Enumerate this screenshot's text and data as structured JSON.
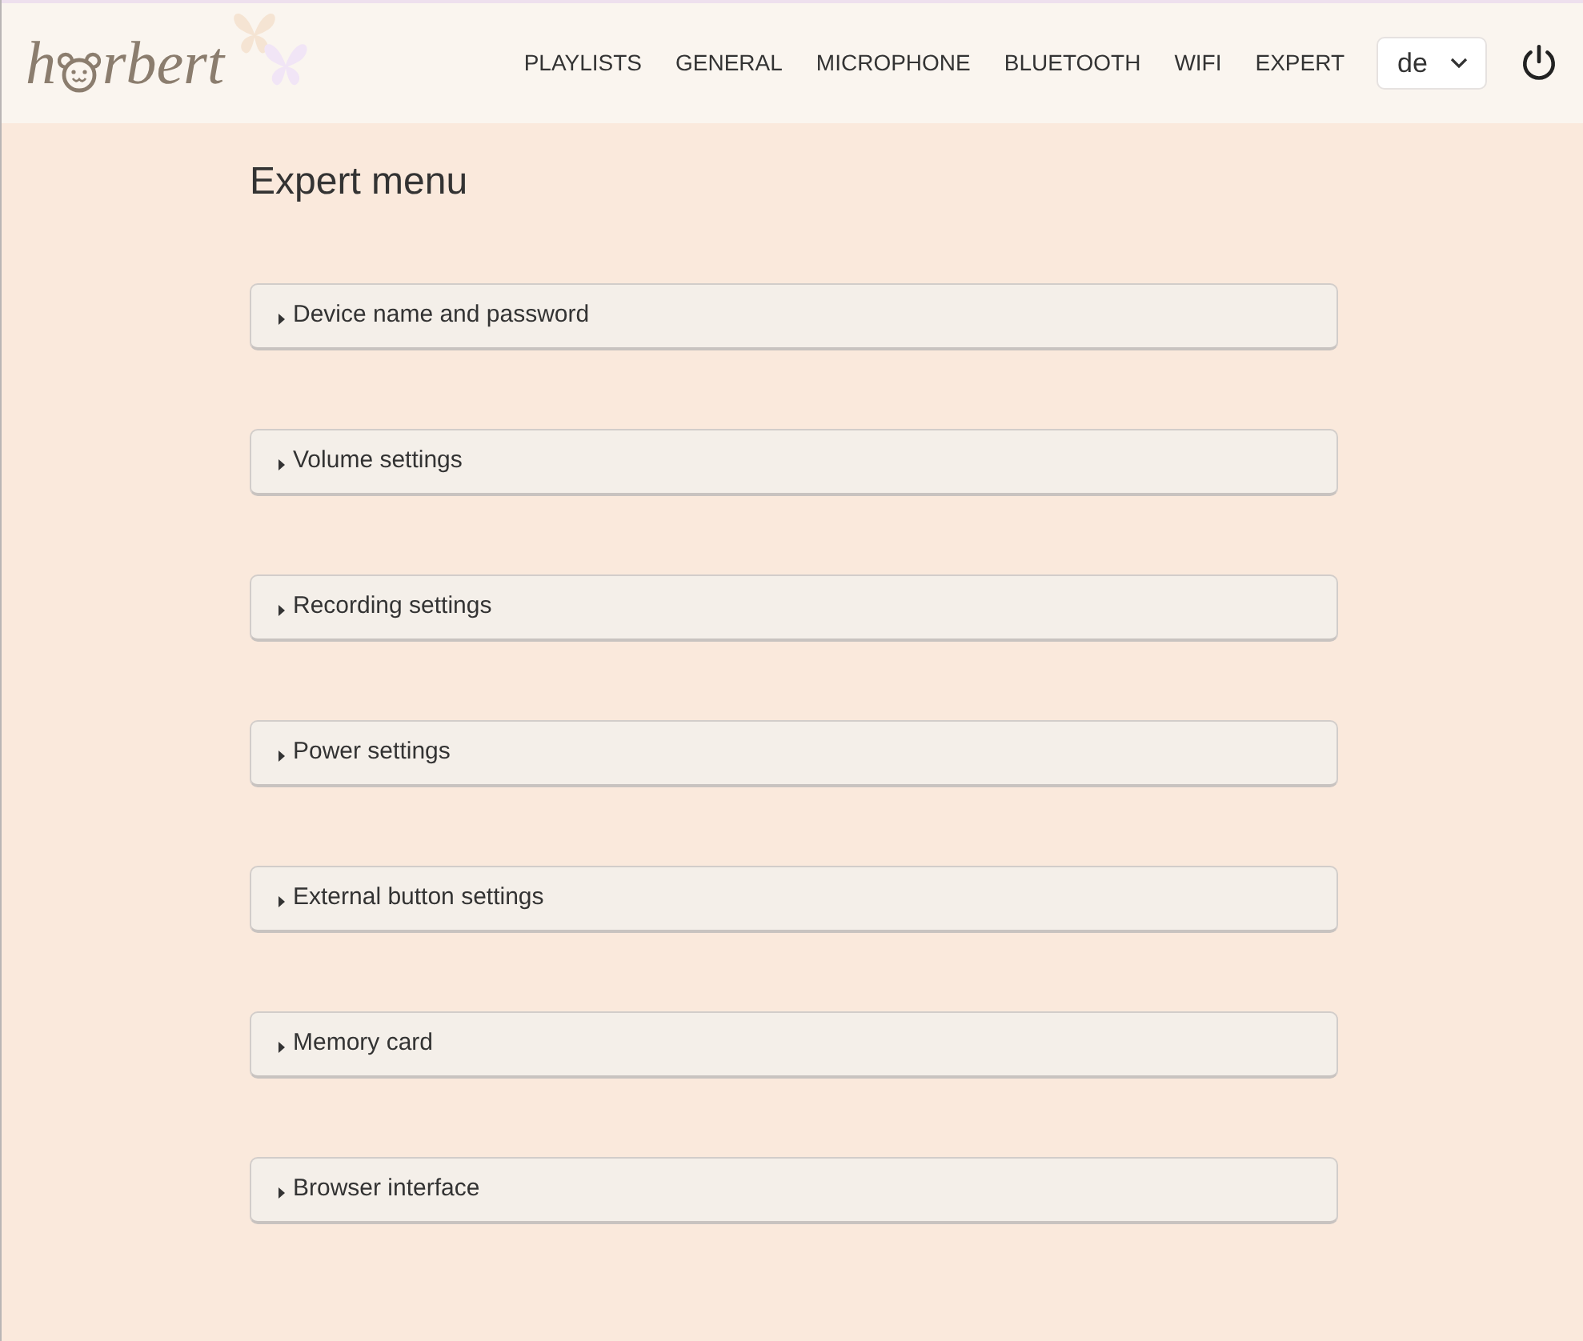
{
  "logo": {
    "before": "h",
    "after": "rbert"
  },
  "nav": {
    "items": [
      "PLAYLISTS",
      "GENERAL",
      "MICROPHONE",
      "BLUETOOTH",
      "WIFI",
      "EXPERT"
    ],
    "language": "de"
  },
  "title": "Expert menu",
  "sections": [
    {
      "label": "Device name and password",
      "expanded": false
    },
    {
      "label": "Volume settings",
      "expanded": false
    },
    {
      "label": "Recording settings",
      "expanded": false
    },
    {
      "label": "Power settings",
      "expanded": false
    },
    {
      "label": "External button settings",
      "expanded": false
    },
    {
      "label": "Memory card",
      "expanded": false
    },
    {
      "label": "Browser interface",
      "expanded": false
    }
  ]
}
